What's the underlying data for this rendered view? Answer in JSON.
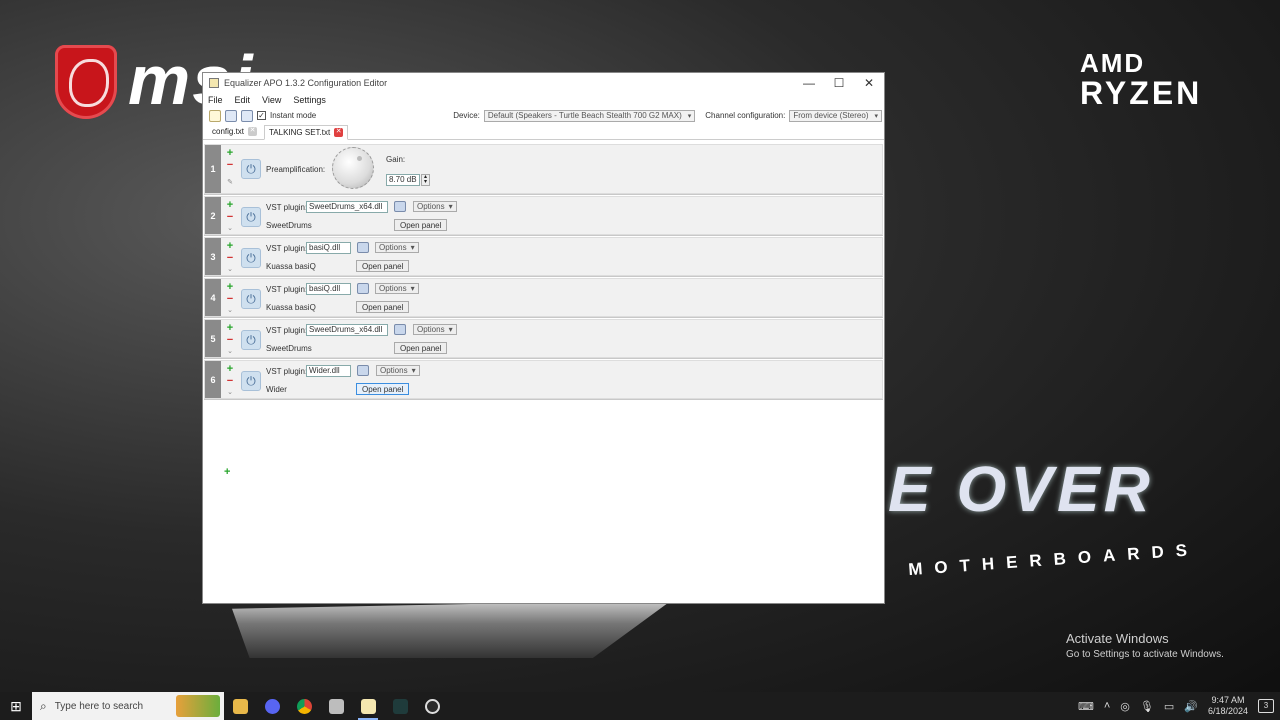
{
  "desktop": {
    "brand_left": "msi",
    "amd_line1": "AMD",
    "amd_line2": "RYZEN",
    "game_over": "E OVER",
    "motherboards": "MOTHERBOARDS",
    "activate_title": "Activate Windows",
    "activate_sub": "Go to Settings to activate Windows."
  },
  "window": {
    "title": "Equalizer APO 1.3.2 Configuration Editor",
    "minimize": "—",
    "maximize": "☐",
    "close": "✕",
    "menu": [
      "File",
      "Edit",
      "View",
      "Settings"
    ],
    "instant_mode_label": "Instant mode",
    "instant_mode_checked": "✓",
    "device_label": "Device:",
    "device_value": "Default (Speakers - Turtle Beach Stealth 700 G2 MAX)",
    "channel_label": "Channel configuration:",
    "channel_value": "From device (Stereo)",
    "tabs": [
      {
        "label": "config.txt",
        "close": "✕"
      },
      {
        "label": "TALKING SET.txt",
        "close": "✕"
      }
    ]
  },
  "filters": {
    "row1": {
      "num": "1",
      "label": "Preamplification:",
      "gain_label": "Gain:",
      "gain_value": "8.70 dB"
    },
    "row2": {
      "num": "2",
      "plugin_label": "VST plugin:",
      "plugin_file": "SweetDrums_x64.dll",
      "options": "Options",
      "name": "SweetDrums",
      "open": "Open panel"
    },
    "row3": {
      "num": "3",
      "plugin_label": "VST plugin:",
      "plugin_file": "basiQ.dll",
      "options": "Options",
      "name": "Kuassa basiQ",
      "open": "Open panel"
    },
    "row4": {
      "num": "4",
      "plugin_label": "VST plugin:",
      "plugin_file": "basiQ.dll",
      "options": "Options",
      "name": "Kuassa basiQ",
      "open": "Open panel"
    },
    "row5": {
      "num": "5",
      "plugin_label": "VST plugin:",
      "plugin_file": "SweetDrums_x64.dll",
      "options": "Options",
      "name": "SweetDrums",
      "open": "Open panel"
    },
    "row6": {
      "num": "6",
      "plugin_label": "VST plugin:",
      "plugin_file": "Wider.dll",
      "options": "Options",
      "name": "Wider",
      "open": "Open panel"
    }
  },
  "taskbar": {
    "search_placeholder": "Type here to search",
    "time": "9:47 AM",
    "date": "6/18/2024",
    "notifications": "3"
  }
}
